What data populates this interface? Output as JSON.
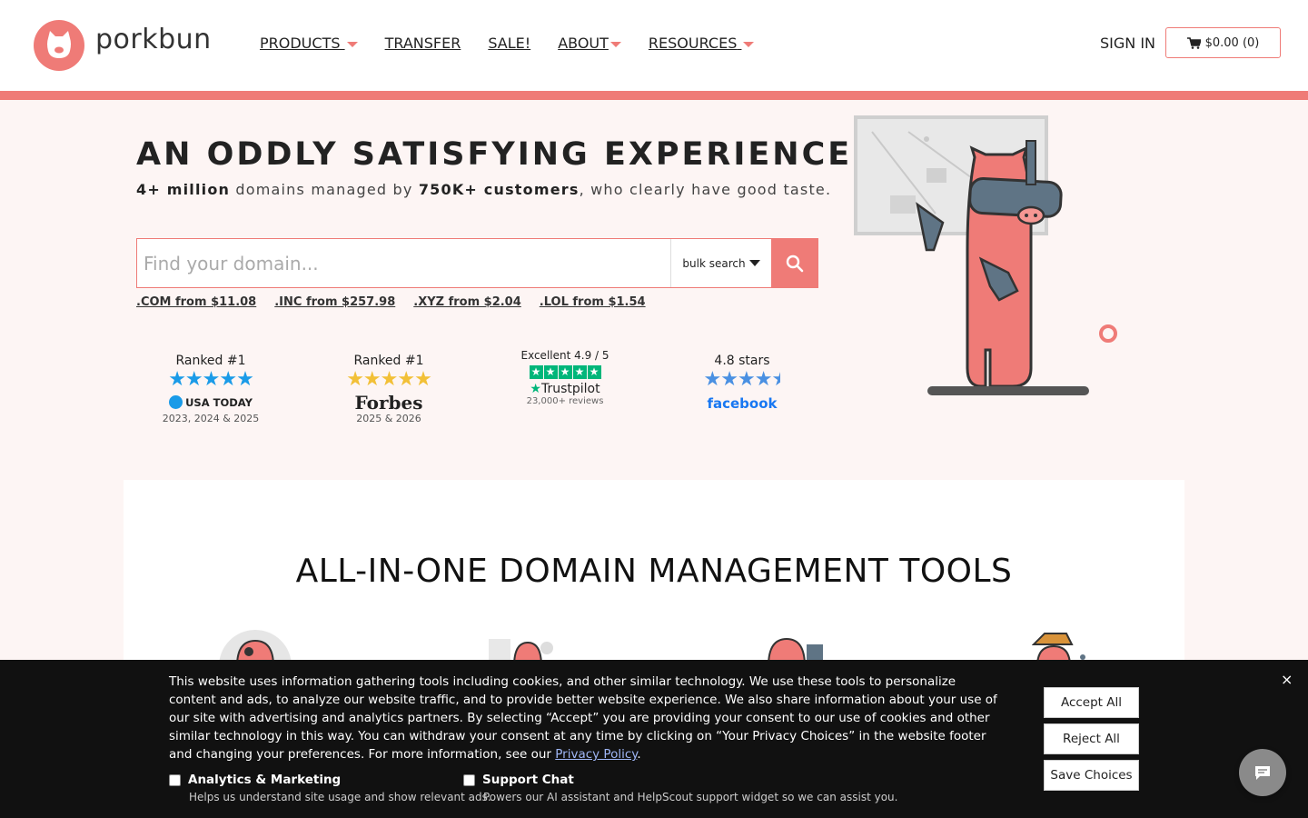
{
  "header": {
    "brand": "porkbun",
    "nav": [
      {
        "label": "PRODUCTS",
        "has_caret": true
      },
      {
        "label": "TRANSFER",
        "has_caret": false
      },
      {
        "label": "SALE!",
        "has_caret": false
      },
      {
        "label": "ABOUT",
        "has_caret": true
      },
      {
        "label": "RESOURCES",
        "has_caret": true
      }
    ],
    "sign_in": "SIGN IN",
    "cart": "$0.00 (0)"
  },
  "hero": {
    "title": "AN ODDLY SATISFYING EXPERIENCE.",
    "sub_strong1": "4+ million",
    "sub_mid": " domains managed by ",
    "sub_strong2": "750K+ customers",
    "sub_end": ", who clearly have good taste.",
    "search_placeholder": "Find your domain...",
    "bulk_label": "bulk search",
    "tlds": [
      ".COM from $11.08",
      ".INC from $257.98",
      ".XYZ from $2.04",
      ".LOL from $1.54"
    ]
  },
  "ratings": {
    "usatoday": {
      "title": "Ranked #1",
      "brand": "USA TODAY",
      "years": "2023, 2024 & 2025"
    },
    "forbes": {
      "title": "Ranked #1",
      "brand": "Forbes",
      "years": "2025 & 2026"
    },
    "trustpilot": {
      "title": "Excellent  4.9 / 5",
      "brand": "Trustpilot",
      "years": "23,000+ reviews"
    },
    "facebook": {
      "title": "4.8 stars",
      "brand": "facebook"
    }
  },
  "tools": {
    "title": "ALL-IN-ONE DOMAIN MANAGEMENT TOOLS"
  },
  "cookie": {
    "text": "This website uses information gathering tools including cookies, and other similar technology. We use these tools to personalize content and ads, to analyze our website traffic, and to provide better website experience. We also share information about your use of our site with advertising and analytics partners. By selecting “Accept” you are providing your consent to our use of cookies and other similar technology in this way. You can withdraw your consent at any time by clicking on “Your Privacy Choices” in the website footer and changing your preferences. For more information, see our ",
    "link": "Privacy Policy",
    "end": ".",
    "analytics_label": "Analytics & Marketing",
    "analytics_desc": "Helps us understand site usage and show relevant ads.",
    "support_label": "Support Chat",
    "support_desc": "Powers our AI assistant and HelpScout support widget so we can assist you.",
    "accept": "Accept All",
    "reject": "Reject All",
    "save": "Save Choices",
    "close": "×"
  },
  "colors": {
    "brand": "#ef7b77",
    "hero_bg": "#fdf5f4",
    "banner_bg": "#111111"
  }
}
